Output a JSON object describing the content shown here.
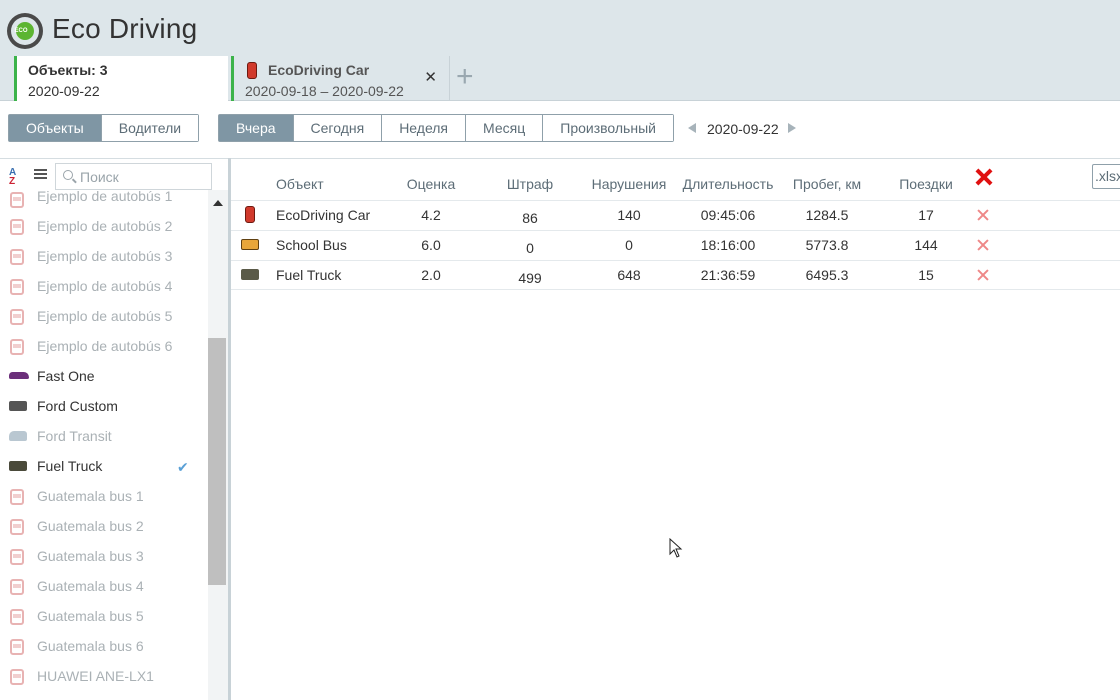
{
  "app": {
    "title": "Eco Driving",
    "logo_text": "ECO"
  },
  "tabs": [
    {
      "title": "Объекты: 3",
      "subtitle": "2020-09-22"
    },
    {
      "title": "EcoDriving Car",
      "subtitle": "2020-09-18  –  2020-09-22",
      "close": "✕"
    }
  ],
  "tab_add": "+",
  "mode_switch": [
    "Объекты",
    "Водители"
  ],
  "period_switch": [
    "Вчера",
    "Сегодня",
    "Неделя",
    "Месяц",
    "Произвольный"
  ],
  "date_nav": {
    "date": "2020-09-22"
  },
  "sidebar": {
    "search_placeholder": "Поиск",
    "items": [
      {
        "label": "Ejemplo de autobús 1",
        "icon": "bus-icon"
      },
      {
        "label": "Ejemplo de autobús 2",
        "icon": "bus-icon"
      },
      {
        "label": "Ejemplo de autobús 3",
        "icon": "bus-icon"
      },
      {
        "label": "Ejemplo de autobús 4",
        "icon": "bus-icon"
      },
      {
        "label": "Ejemplo de autobús 5",
        "icon": "bus-icon"
      },
      {
        "label": "Ejemplo de autobús 6",
        "icon": "bus-icon"
      },
      {
        "label": "Fast One",
        "icon": "sports-car-icon"
      },
      {
        "label": "Ford Custom",
        "icon": "van-icon"
      },
      {
        "label": "Ford Transit",
        "icon": "van-icon"
      },
      {
        "label": "Fuel Truck",
        "icon": "truck-icon",
        "checked": true
      },
      {
        "label": "Guatemala bus 1",
        "icon": "bus-icon"
      },
      {
        "label": "Guatemala bus 2",
        "icon": "bus-icon"
      },
      {
        "label": "Guatemala bus 3",
        "icon": "bus-icon"
      },
      {
        "label": "Guatemala bus 4",
        "icon": "bus-icon"
      },
      {
        "label": "Guatemala bus 5",
        "icon": "bus-icon"
      },
      {
        "label": "Guatemala bus 6",
        "icon": "bus-icon"
      },
      {
        "label": "HUAWEI ANE-LX1",
        "icon": "bus-icon"
      }
    ]
  },
  "table": {
    "columns": [
      "Объект",
      "Оценка",
      "Штраф",
      "Нарушения",
      "Длительность",
      "Пробег, км",
      "Поездки"
    ],
    "export_label": ".xlsx",
    "rows": [
      {
        "object": "EcoDriving Car",
        "rating": "4.2",
        "penalty": "86",
        "violations": "140",
        "duration": "09:45:06",
        "mileage": "1284.5",
        "trips": "17",
        "icon": "car-icon"
      },
      {
        "object": "School Bus",
        "rating": "6.0",
        "penalty": "0",
        "violations": "0",
        "duration": "18:16:00",
        "mileage": "5773.8",
        "trips": "144",
        "icon": "school-bus-icon"
      },
      {
        "object": "Fuel Truck",
        "rating": "2.0",
        "penalty": "499",
        "violations": "648",
        "duration": "21:36:59",
        "mileage": "6495.3",
        "trips": "15",
        "icon": "truck-icon"
      }
    ]
  }
}
